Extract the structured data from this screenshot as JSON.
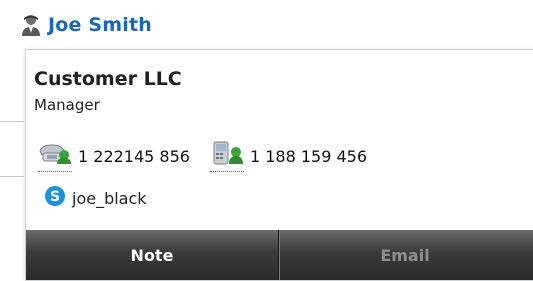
{
  "contact": {
    "name": "Joe Smith",
    "company": "Customer LLC",
    "job_title": "Manager",
    "phone_office": "1 222145 856",
    "phone_mobile": "1 188 159 456",
    "skype": "joe_black"
  },
  "toolbar": {
    "note_label": "Note",
    "email_label": "Email"
  },
  "icons": {
    "user": "user-icon",
    "office_phone": "office-phone-icon",
    "mobile_phone": "mobile-phone-icon",
    "skype": "skype-icon"
  },
  "colors": {
    "name_link": "#1a66b8",
    "toolbar": "#2f2f2f",
    "status_green": "#3aa53a",
    "skype_blue": "#1e90e0"
  }
}
